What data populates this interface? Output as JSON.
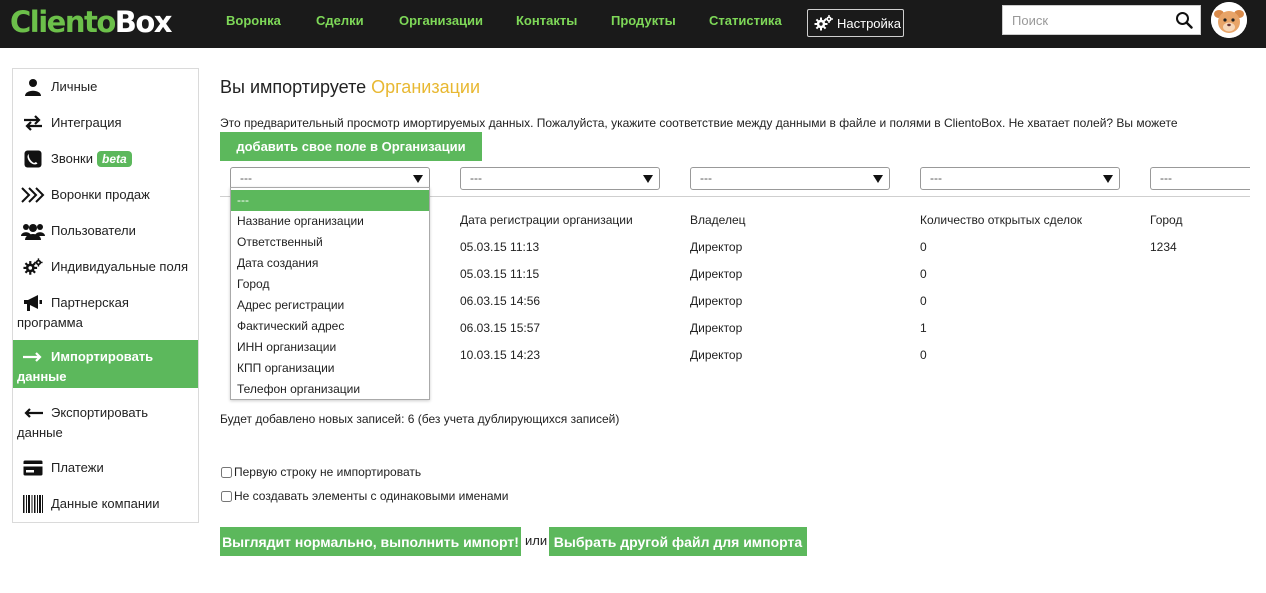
{
  "logo": {
    "part1": "Cliento",
    "part2": "Box"
  },
  "nav": [
    "Воронка",
    "Сделки",
    "Организации",
    "Контакты",
    "Продукты",
    "Статистика"
  ],
  "settings_label": "Настройка",
  "search": {
    "placeholder": "Поиск",
    "value": ""
  },
  "sidebar": {
    "items": [
      {
        "label": "Личные",
        "icon": "user-icon"
      },
      {
        "label": "Интеграция",
        "icon": "arrows-exchange-icon"
      },
      {
        "label": "Звонки",
        "badge": "beta",
        "icon": "phone-icon"
      },
      {
        "label": "Воронки продаж",
        "icon": "chevrons-right-icon"
      },
      {
        "label": "Пользователи",
        "icon": "users-icon"
      },
      {
        "label": "Индивидуальные поля",
        "icon": "gears-icon"
      },
      {
        "label_line1": "Партнерская",
        "label_line2": "программа",
        "icon": "megaphone-icon"
      },
      {
        "label_line1": "Импортировать",
        "label_line2": "данные",
        "icon": "arrow-right-icon",
        "active": true
      },
      {
        "label_line1": "Экспортировать",
        "label_line2": "данные",
        "icon": "arrow-left-icon"
      },
      {
        "label": "Платежи",
        "icon": "credit-card-icon"
      },
      {
        "label": "Данные компании",
        "icon": "barcode-icon"
      }
    ]
  },
  "main": {
    "title_prefix": "Вы импортируете ",
    "title_entity": "Организации",
    "description": "Это предварительный просмотр имортируемых данных. Пожалуйста, укажите соответствие между данными в файле и полями в ClientoBox. Не хватает полей? Вы можете",
    "add_field_button": "добавить свое поле в Организации",
    "selects": [
      "---",
      "---",
      "---",
      "---",
      "---"
    ],
    "dropdown_options": [
      "---",
      "Название организации",
      "Ответственный",
      "Дата создания",
      "Город",
      "Адрес регистрации",
      "Фактический адрес",
      "ИНН организации",
      "КПП организации",
      "Телефон организации"
    ],
    "columns": [
      "",
      "Дата регистрации организации",
      "Владелец",
      "Количество открытых сделок",
      "Город"
    ],
    "rows": [
      [
        "",
        "05.03.15 11:13",
        "Директор",
        "0",
        "1234"
      ],
      [
        "",
        "05.03.15 11:15",
        "Директор",
        "0",
        ""
      ],
      [
        "",
        "06.03.15 14:56",
        "Директор",
        "0",
        ""
      ],
      [
        "",
        "06.03.15 15:57",
        "Директор",
        "1",
        ""
      ],
      [
        "",
        "10.03.15 14:23",
        "Директор",
        "0",
        ""
      ]
    ],
    "summary": "Будет добавлено новых записей: 6 (без учета дублирующихся записей)",
    "checkbox_skip_first": "Первую строку не импортировать",
    "checkbox_no_duplicates": "Не создавать элементы с одинаковыми именами",
    "import_button": "Выглядит нормально, выполнить импорт!",
    "or_label": "или",
    "choose_file_button": "Выбрать другой файл для импорта"
  },
  "colors": {
    "accent_green": "#5cb85c",
    "nav_green": "#7ed858",
    "title_highlight": "#e8b832",
    "topbar_bg": "#1a1a1a"
  }
}
